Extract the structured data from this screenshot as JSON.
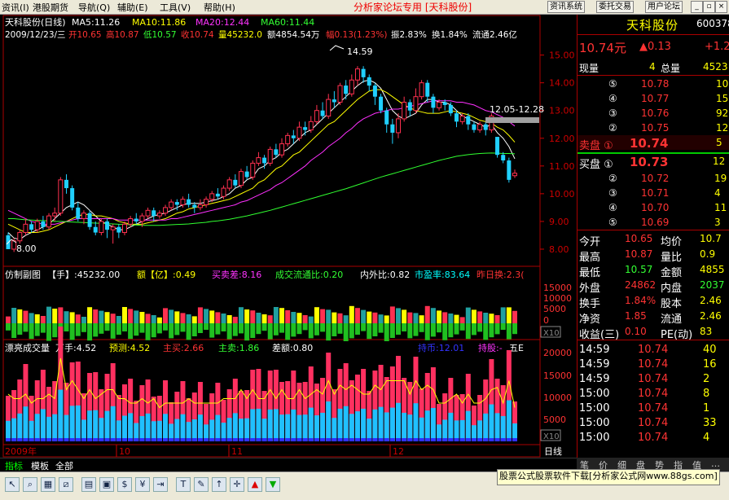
{
  "menu": {
    "items": [
      "资讯(I)",
      "港股期货",
      "导航(Q)",
      "辅助(E)",
      "工具(V)",
      "帮助(H)"
    ],
    "center_title": "分析家论坛专用 [天科股份]",
    "right_buttons": [
      "资讯系统",
      "委托交易",
      "用户论坛"
    ],
    "win_buttons": [
      "_",
      "▫",
      "×"
    ]
  },
  "main_header": {
    "stock": "天科股份(日线)",
    "ma5": "MA5:11.26",
    "ma10": "MA10:11.86",
    "ma20": "MA20:12.44",
    "ma60": "MA60:11.44",
    "date": "2009/12/23/三",
    "open": "开10.65",
    "high": "高10.87",
    "low": "低10.57",
    "close": "收10.74",
    "vol": "量45232.0",
    "amt": "额4854.54万",
    "chg": "幅0.13(1.23%)",
    "amp": "振2.83%",
    "turn": "换1.84%",
    "float": "流通2.46亿"
  },
  "annotations": {
    "high_mark": "14.59",
    "low_mark": "8.00",
    "gap": "12.05-12.28"
  },
  "sub1": {
    "title": "仿制副图",
    "hand": "【手】:45232.00",
    "amount": "额【亿】:0.49",
    "diff": "买卖差:8.16",
    "ratio": "成交流通比:0.20",
    "inout": "内外比:0.82",
    "pe": "市盈率:83.64",
    "prev": "昨日换:2.3("
  },
  "sub2": {
    "title": "漂亮成交量",
    "wan": "万手:4.52",
    "predict": "预测:4.52",
    "main_buy": "主买:2.66",
    "main_sell": "主卖:1.86",
    "diff": "差额:0.80",
    "hold": "持币:12.01",
    "stock_hold": "持股:-",
    "five": "五E"
  },
  "x_labels": [
    "2009年",
    "10",
    "11",
    "12"
  ],
  "period_label": "日线",
  "x10": "X10",
  "colors": {
    "up": "#ff3050",
    "down": "#20d0ff",
    "ma5": "#ffffff",
    "ma10": "#ffff00",
    "ma20": "#ff30ff",
    "ma60": "#30ff30",
    "axis": "#c00000"
  },
  "chart_data": {
    "type": "candlestick",
    "y_ticks": [
      8.0,
      9.0,
      10.0,
      11.0,
      12.0,
      13.0,
      14.0,
      15.0
    ],
    "ylim": [
      7.5,
      15.4
    ],
    "candles": [
      [
        8.5,
        8.0,
        8.6,
        8.0
      ],
      [
        8.0,
        8.3,
        8.4,
        7.9
      ],
      [
        8.3,
        8.6,
        8.7,
        8.2
      ],
      [
        8.6,
        8.9,
        9.1,
        8.5
      ],
      [
        8.9,
        8.7,
        9.0,
        8.6
      ],
      [
        8.7,
        9.0,
        9.1,
        8.6
      ],
      [
        9.0,
        8.8,
        9.2,
        8.7
      ],
      [
        8.8,
        9.2,
        9.3,
        8.7
      ],
      [
        9.2,
        9.3,
        9.5,
        9.0
      ],
      [
        9.3,
        10.5,
        10.6,
        9.2
      ],
      [
        10.5,
        10.2,
        10.7,
        10.0
      ],
      [
        10.2,
        9.5,
        10.3,
        9.4
      ],
      [
        9.5,
        9.1,
        9.7,
        9.0
      ],
      [
        9.1,
        9.3,
        9.4,
        8.9
      ],
      [
        9.3,
        8.8,
        9.4,
        8.7
      ],
      [
        8.8,
        8.6,
        9.0,
        8.5
      ],
      [
        8.6,
        9.0,
        9.1,
        8.5
      ],
      [
        9.0,
        8.7,
        9.1,
        8.4
      ],
      [
        8.7,
        8.8,
        8.9,
        8.2
      ],
      [
        8.8,
        8.6,
        8.9,
        8.4
      ],
      [
        8.6,
        8.9,
        9.0,
        8.5
      ],
      [
        8.9,
        9.1,
        9.2,
        8.8
      ],
      [
        9.1,
        9.0,
        9.3,
        8.9
      ],
      [
        9.0,
        9.2,
        9.3,
        8.8
      ],
      [
        9.2,
        9.4,
        9.5,
        9.1
      ],
      [
        9.4,
        9.2,
        9.5,
        9.0
      ],
      [
        9.2,
        9.3,
        9.4,
        9.1
      ],
      [
        9.3,
        9.5,
        9.6,
        9.2
      ],
      [
        9.5,
        9.7,
        9.8,
        9.4
      ],
      [
        9.7,
        9.6,
        9.8,
        9.4
      ],
      [
        9.6,
        9.8,
        9.9,
        9.5
      ],
      [
        9.8,
        9.6,
        10.0,
        9.5
      ],
      [
        9.6,
        9.5,
        9.7,
        9.3
      ],
      [
        9.5,
        9.6,
        9.8,
        9.4
      ],
      [
        9.6,
        9.8,
        9.9,
        9.5
      ],
      [
        9.8,
        10.0,
        10.1,
        9.7
      ],
      [
        10.0,
        9.9,
        10.2,
        9.8
      ],
      [
        9.9,
        10.2,
        10.3,
        9.8
      ],
      [
        10.2,
        10.5,
        10.6,
        10.1
      ],
      [
        10.5,
        10.3,
        10.7,
        10.2
      ],
      [
        10.3,
        10.8,
        10.9,
        10.2
      ],
      [
        10.8,
        10.6,
        11.0,
        10.5
      ],
      [
        10.6,
        11.1,
        11.2,
        10.5
      ],
      [
        11.1,
        11.3,
        11.5,
        11.0
      ],
      [
        11.3,
        11.1,
        11.4,
        10.9
      ],
      [
        11.1,
        11.6,
        11.7,
        11.0
      ],
      [
        11.6,
        11.4,
        11.8,
        11.3
      ],
      [
        11.4,
        11.8,
        12.0,
        11.3
      ],
      [
        11.8,
        12.1,
        12.2,
        11.7
      ],
      [
        12.1,
        12.0,
        12.3,
        11.8
      ],
      [
        12.0,
        12.4,
        12.6,
        11.9
      ],
      [
        12.4,
        12.3,
        12.6,
        12.1
      ],
      [
        12.3,
        12.6,
        12.8,
        12.2
      ],
      [
        12.6,
        13.0,
        13.2,
        12.5
      ],
      [
        13.0,
        12.8,
        13.3,
        12.7
      ],
      [
        12.8,
        13.4,
        13.6,
        12.7
      ],
      [
        13.4,
        13.3,
        13.7,
        13.1
      ],
      [
        13.3,
        13.9,
        14.0,
        13.2
      ],
      [
        13.9,
        13.6,
        14.1,
        13.4
      ],
      [
        13.6,
        14.1,
        14.3,
        13.5
      ],
      [
        14.1,
        14.5,
        14.6,
        13.9
      ],
      [
        14.5,
        14.2,
        14.6,
        14.0
      ],
      [
        14.2,
        13.9,
        14.3,
        13.7
      ],
      [
        13.9,
        13.5,
        14.0,
        13.2
      ],
      [
        13.5,
        13.0,
        13.6,
        12.9
      ],
      [
        13.0,
        12.5,
        13.1,
        12.2
      ],
      [
        12.5,
        12.2,
        12.7,
        11.8
      ],
      [
        12.2,
        12.7,
        12.9,
        12.0
      ],
      [
        12.7,
        13.3,
        13.5,
        12.6
      ],
      [
        13.3,
        13.0,
        13.4,
        12.8
      ],
      [
        13.0,
        13.5,
        13.8,
        12.9
      ],
      [
        13.5,
        14.0,
        14.1,
        13.4
      ],
      [
        14.0,
        13.5,
        14.1,
        13.3
      ],
      [
        13.5,
        13.1,
        13.6,
        12.9
      ],
      [
        13.1,
        13.3,
        13.4,
        13.0
      ],
      [
        13.3,
        13.2,
        13.4,
        13.0
      ],
      [
        13.2,
        12.9,
        13.3,
        12.8
      ],
      [
        12.9,
        12.6,
        13.0,
        12.4
      ],
      [
        12.6,
        12.8,
        12.9,
        12.5
      ],
      [
        12.8,
        12.5,
        12.9,
        12.3
      ],
      [
        12.5,
        12.3,
        12.6,
        12.2
      ],
      [
        12.3,
        12.5,
        12.6,
        12.2
      ],
      [
        12.5,
        12.3,
        12.6,
        12.1
      ],
      [
        12.3,
        12.8,
        12.9,
        12.2
      ],
      [
        12.05,
        11.4,
        12.05,
        11.3
      ],
      [
        11.4,
        11.2,
        11.5,
        11.1
      ],
      [
        11.2,
        10.5,
        11.3,
        10.4
      ],
      [
        10.65,
        10.74,
        10.87,
        10.57
      ]
    ],
    "ma_series": [
      {
        "name": "MA5",
        "values": [
          8.6,
          8.4,
          8.35,
          8.5,
          8.6,
          8.7,
          8.8,
          8.9,
          9.1,
          9.3,
          9.5,
          9.6,
          9.7,
          9.6,
          9.4,
          9.2,
          9.0,
          8.9,
          8.8,
          8.7,
          8.7,
          8.8,
          8.9,
          9.0,
          9.1,
          9.2,
          9.25,
          9.3,
          9.4,
          9.5,
          9.6,
          9.65,
          9.65,
          9.65,
          9.7,
          9.75,
          9.8,
          9.9,
          10.0,
          10.2,
          10.3,
          10.5,
          10.6,
          10.9,
          11.0,
          11.2,
          11.3,
          11.5,
          11.6,
          11.8,
          12.0,
          12.2,
          12.3,
          12.5,
          12.7,
          12.9,
          13.1,
          13.3,
          13.5,
          13.7,
          13.9,
          14.05,
          14.1,
          14.0,
          13.8,
          13.4,
          13.0,
          12.8,
          12.7,
          12.8,
          12.9,
          13.2,
          13.4,
          13.4,
          13.3,
          13.3,
          13.2,
          13.0,
          12.8,
          12.7,
          12.6,
          12.5,
          12.4,
          12.5,
          12.2,
          12.0,
          11.7,
          11.26
        ]
      },
      {
        "name": "MA10",
        "values": [
          8.9,
          8.8,
          8.7,
          8.6,
          8.6,
          8.6,
          8.65,
          8.7,
          8.8,
          8.9,
          9.0,
          9.1,
          9.2,
          9.25,
          9.25,
          9.2,
          9.2,
          9.15,
          9.1,
          9.0,
          8.95,
          8.9,
          8.9,
          8.9,
          8.95,
          9.0,
          9.05,
          9.1,
          9.2,
          9.3,
          9.35,
          9.45,
          9.5,
          9.55,
          9.6,
          9.65,
          9.7,
          9.75,
          9.8,
          9.9,
          10.0,
          10.1,
          10.2,
          10.4,
          10.5,
          10.7,
          10.9,
          11.0,
          11.2,
          11.4,
          11.5,
          11.7,
          11.9,
          12.1,
          12.3,
          12.5,
          12.6,
          12.8,
          13.0,
          13.2,
          13.4,
          13.55,
          13.7,
          13.75,
          13.75,
          13.65,
          13.5,
          13.35,
          13.2,
          13.1,
          13.0,
          12.95,
          12.9,
          12.9,
          12.9,
          12.95,
          13.0,
          12.95,
          12.9,
          12.85,
          12.75,
          12.65,
          12.6,
          12.55,
          12.4,
          12.3,
          12.1,
          11.86
        ]
      },
      {
        "name": "MA20",
        "values": [
          9.4,
          9.3,
          9.2,
          9.1,
          9.0,
          8.95,
          8.9,
          8.9,
          8.9,
          8.95,
          9.0,
          9.05,
          9.1,
          9.1,
          9.1,
          9.1,
          9.1,
          9.1,
          9.1,
          9.05,
          9.05,
          9.05,
          9.05,
          9.05,
          9.05,
          9.05,
          9.05,
          9.05,
          9.1,
          9.1,
          9.15,
          9.2,
          9.25,
          9.3,
          9.35,
          9.4,
          9.45,
          9.5,
          9.55,
          9.6,
          9.7,
          9.75,
          9.85,
          9.95,
          10.05,
          10.15,
          10.3,
          10.4,
          10.55,
          10.7,
          10.85,
          11.0,
          11.2,
          11.35,
          11.5,
          11.7,
          11.85,
          12.0,
          12.2,
          12.35,
          12.55,
          12.7,
          12.8,
          12.9,
          12.95,
          13.0,
          13.05,
          13.05,
          13.1,
          13.15,
          13.2,
          13.25,
          13.3,
          13.35,
          13.35,
          13.35,
          13.35,
          13.3,
          13.3,
          13.25,
          13.2,
          13.1,
          13.0,
          12.95,
          12.85,
          12.75,
          12.6,
          12.44
        ]
      },
      {
        "name": "MA60",
        "values": [
          9.1,
          9.1,
          9.08,
          9.06,
          9.05,
          9.04,
          9.03,
          9.02,
          9.0,
          9.0,
          8.99,
          8.98,
          8.97,
          8.96,
          8.95,
          8.94,
          8.93,
          8.92,
          8.91,
          8.9,
          8.89,
          8.88,
          8.87,
          8.86,
          8.86,
          8.86,
          8.86,
          8.87,
          8.88,
          8.89,
          8.9,
          8.91,
          8.93,
          8.95,
          8.97,
          9.0,
          9.02,
          9.05,
          9.08,
          9.12,
          9.16,
          9.2,
          9.25,
          9.3,
          9.35,
          9.4,
          9.46,
          9.52,
          9.58,
          9.64,
          9.7,
          9.76,
          9.82,
          9.88,
          9.94,
          10.0,
          10.06,
          10.12,
          10.18,
          10.25,
          10.32,
          10.39,
          10.46,
          10.53,
          10.6,
          10.66,
          10.72,
          10.78,
          10.84,
          10.9,
          10.96,
          11.02,
          11.08,
          11.14,
          11.2,
          11.25,
          11.3,
          11.35,
          11.38,
          11.41,
          11.43,
          11.45,
          11.46,
          11.47,
          11.46,
          11.45,
          11.45,
          11.44
        ]
      }
    ],
    "sub1_ticks": [
      "15000",
      "10000",
      "5000",
      "0"
    ],
    "sub2_ticks": [
      "20000",
      "15000",
      "10000",
      "5000"
    ]
  },
  "quote": {
    "name": "天科股份",
    "code": "600378",
    "price": "10.74元",
    "chg_arrow": "▲0.13",
    "chg_right": "+1.2",
    "now_vol_label": "现量",
    "now_vol": "4",
    "total_label": "总量",
    "total": "4523",
    "sells": [
      {
        "lv": "⑤",
        "price": "10.78",
        "vol": "10"
      },
      {
        "lv": "④",
        "price": "10.77",
        "vol": "15"
      },
      {
        "lv": "③",
        "price": "10.76",
        "vol": "92"
      },
      {
        "lv": "②",
        "price": "10.75",
        "vol": "12"
      }
    ],
    "sell1_label": "卖盘 ①",
    "sell1_price": "10.74",
    "sell1_vol": "5",
    "buy1_label": "买盘 ①",
    "buy1_price": "10.73",
    "buy1_vol": "12",
    "buys": [
      {
        "lv": "②",
        "price": "10.72",
        "vol": "19"
      },
      {
        "lv": "③",
        "price": "10.71",
        "vol": "4"
      },
      {
        "lv": "④",
        "price": "10.70",
        "vol": "11"
      },
      {
        "lv": "⑤",
        "price": "10.69",
        "vol": "3"
      }
    ],
    "stats": [
      {
        "l1": "今开",
        "v1": "10.65",
        "l2": "均价",
        "v2": "10.7"
      },
      {
        "l1": "最高",
        "v1": "10.87",
        "l2": "量比",
        "v2": "0.9"
      },
      {
        "l1": "最低",
        "v1": "10.57",
        "l2": "金额",
        "v2": "4855"
      },
      {
        "l1": "外盘",
        "v1": "24862",
        "l2": "内盘",
        "v2": "2037"
      },
      {
        "l1": "换手",
        "v1": "1.84%",
        "l2": "股本",
        "v2": "2.46"
      },
      {
        "l1": "净资",
        "v1": "1.85",
        "l2": "流通",
        "v2": "2.46"
      },
      {
        "l1": "收益(三)",
        "v1": "0.10",
        "l2": "PE(动)",
        "v2": "83"
      }
    ],
    "ticks": [
      {
        "t": "14:59",
        "p": "10.74",
        "v": "40"
      },
      {
        "t": "14:59",
        "p": "10.74",
        "v": "16"
      },
      {
        "t": "14:59",
        "p": "10.74",
        "v": "2"
      },
      {
        "t": "15:00",
        "p": "10.74",
        "v": "8"
      },
      {
        "t": "15:00",
        "p": "10.74",
        "v": "1"
      },
      {
        "t": "15:00",
        "p": "10.74",
        "v": "33"
      },
      {
        "t": "15:00",
        "p": "10.74",
        "v": "4"
      }
    ],
    "tabs": [
      "笔",
      "价",
      "细",
      "盘",
      "势",
      "指",
      "值",
      "…"
    ]
  },
  "bottom_tabs": [
    "指标",
    "模板",
    "全部"
  ],
  "footer_text": "股票公式股票软件下载[分析家公式网www.88gs.com]",
  "toolbar_icons": [
    "select-icon",
    "zoom-icon",
    "chart-icon",
    "draw-icon",
    "stats-icon",
    "delete-icon",
    "dollar-icon",
    "money-icon",
    "export-icon",
    "text-icon",
    "pen-icon",
    "up-arrow-icon",
    "cross-icon",
    "red-up-icon",
    "green-down-icon"
  ]
}
